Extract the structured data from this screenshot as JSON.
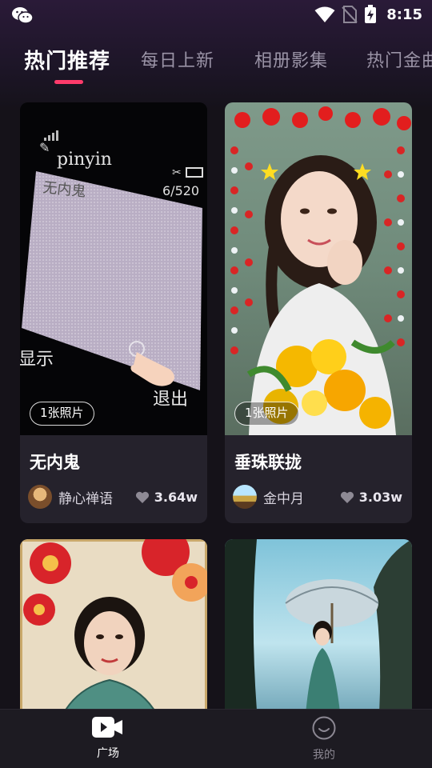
{
  "status_bar": {
    "time": "8:15",
    "icons": [
      "wechat-icon",
      "wifi-icon",
      "no-sim-icon",
      "battery-charging-icon"
    ]
  },
  "tabs": [
    {
      "label": "热门推荐",
      "active": true
    },
    {
      "label": "每日上新",
      "active": false
    },
    {
      "label": "相册影集",
      "active": false
    },
    {
      "label": "热门金曲",
      "active": false
    }
  ],
  "cards": [
    {
      "title": "无内鬼",
      "badge": "1张照片",
      "author": "静心禅语",
      "likes": "3.64w",
      "media_text": {
        "top": "pinyin",
        "field": "无内鬼",
        "counter": "6/520",
        "left": "显示",
        "right": "退出"
      }
    },
    {
      "title": "垂珠联拢",
      "badge": "1张照片",
      "author": "金中月",
      "likes": "3.03w"
    },
    {
      "title": "",
      "badge": "",
      "author": "",
      "likes": ""
    },
    {
      "title": "",
      "badge": "",
      "author": "",
      "likes": ""
    }
  ],
  "bottom_nav": [
    {
      "label": "广场",
      "icon": "video-play-icon",
      "active": true
    },
    {
      "label": "我的",
      "icon": "smiley-icon",
      "active": false
    }
  ],
  "colors": {
    "accent": "#ff3b6b",
    "background": "#151219",
    "card": "#25222c",
    "inactive_text": "#9a93a6"
  }
}
